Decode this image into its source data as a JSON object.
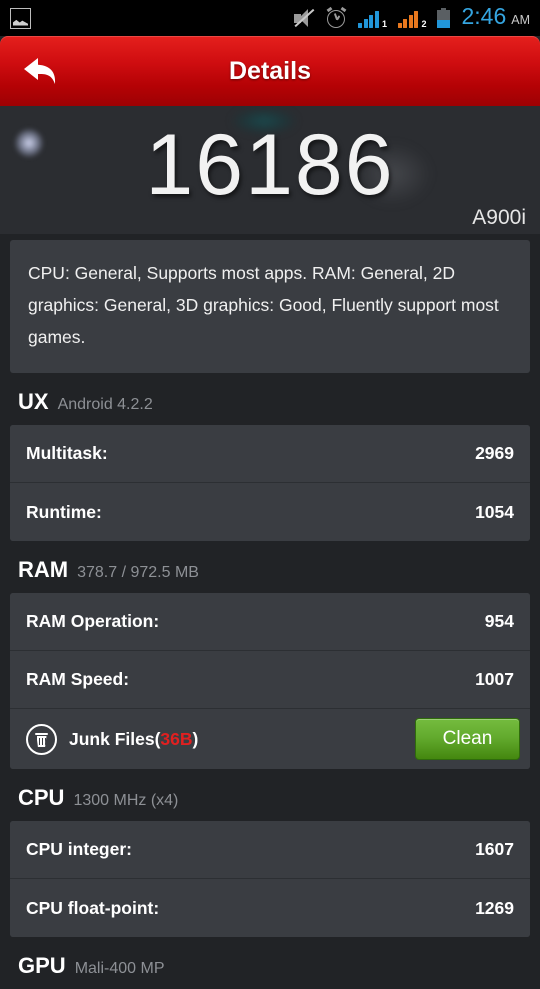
{
  "statusbar": {
    "notification_icon": "screenshot-icon",
    "icons": [
      "mute-icon",
      "alarm-icon",
      "signal-1-icon",
      "signal-2-icon",
      "battery-icon"
    ],
    "sim1_label": "1",
    "sim2_label": "2",
    "time": "2:46",
    "ampm": "AM"
  },
  "header": {
    "back_icon": "back-arrow-icon",
    "title": "Details",
    "bg_color": "#cf0d10"
  },
  "score": {
    "value": "16186",
    "device": "A900i"
  },
  "description": {
    "text": "CPU: General, Supports most apps. RAM: General, 2D graphics: General, 3D graphics: Good, Fluently support most games."
  },
  "sections": {
    "ux": {
      "title": "UX",
      "subtitle": "Android 4.2.2",
      "rows": [
        {
          "label": "Multitask:",
          "value": "2969"
        },
        {
          "label": "Runtime:",
          "value": "1054"
        }
      ]
    },
    "ram": {
      "title": "RAM",
      "subtitle": "378.7 / 972.5 MB",
      "rows": [
        {
          "label": "RAM Operation:",
          "value": "954"
        },
        {
          "label": "RAM Speed:",
          "value": "1007"
        }
      ],
      "junk": {
        "icon": "trash-icon",
        "label_prefix": "Junk Files(",
        "size": "36B",
        "label_suffix": ")",
        "size_color": "#e02020",
        "button_label": "Clean",
        "button_color": "#63ab2e"
      }
    },
    "cpu": {
      "title": "CPU",
      "subtitle": "1300 MHz (x4)",
      "rows": [
        {
          "label": "CPU integer:",
          "value": "1607"
        },
        {
          "label": "CPU float-point:",
          "value": "1269"
        }
      ]
    },
    "gpu": {
      "title": "GPU",
      "subtitle": "Mali-400 MP"
    }
  }
}
